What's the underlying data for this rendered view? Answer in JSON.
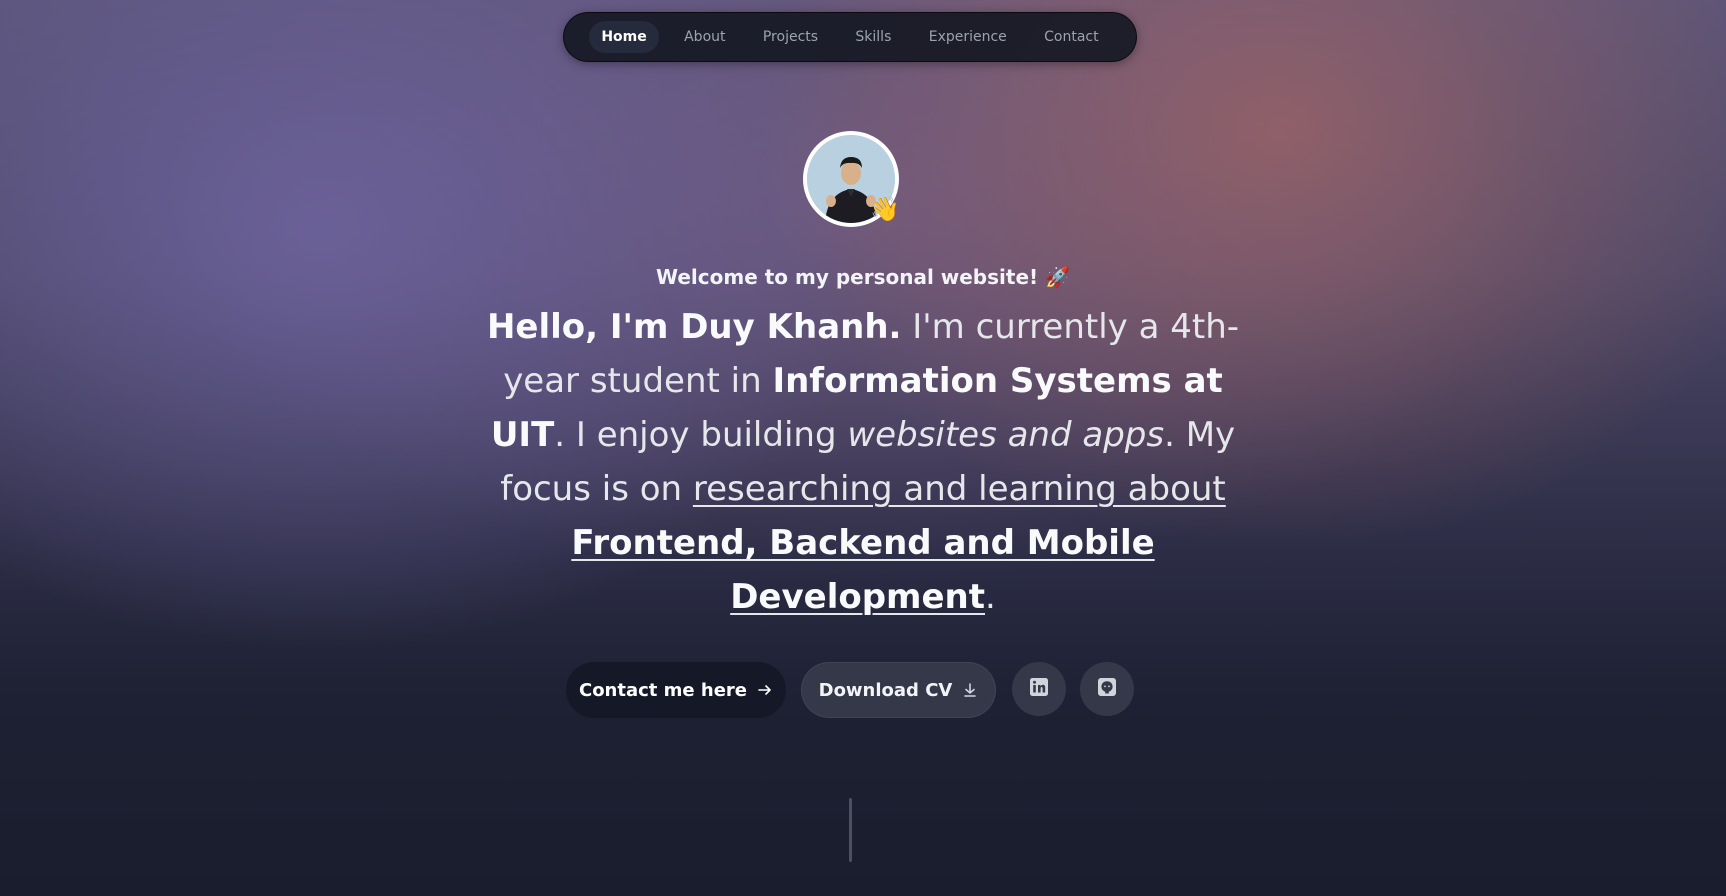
{
  "nav": {
    "items": [
      {
        "label": "Home",
        "active": true
      },
      {
        "label": "About"
      },
      {
        "label": "Projects"
      },
      {
        "label": "Skills"
      },
      {
        "label": "Experience"
      },
      {
        "label": "Contact"
      }
    ]
  },
  "hero": {
    "welcome": "Welcome to my personal website! 🚀",
    "wave_emoji": "👋",
    "headline": {
      "p1": "Hello, I'm Duy Khanh.",
      "p2": " I'm currently a 4th-year student in ",
      "p3": "Information Systems at UIT",
      "p4": ". I enjoy building ",
      "p5": "websites and apps",
      "p6": ". My focus is on ",
      "p7": "researching and learning about ",
      "p8": "Frontend, Backend and Mobile Development",
      "p9": "."
    }
  },
  "actions": {
    "contact_label": "Contact me here",
    "cv_label": "Download CV",
    "linkedin_icon": "linkedin-icon",
    "github_icon": "github-icon"
  },
  "colors": {
    "nav_bg": "#161824",
    "primary_button": "#141827",
    "secondary_button": "#343849"
  }
}
